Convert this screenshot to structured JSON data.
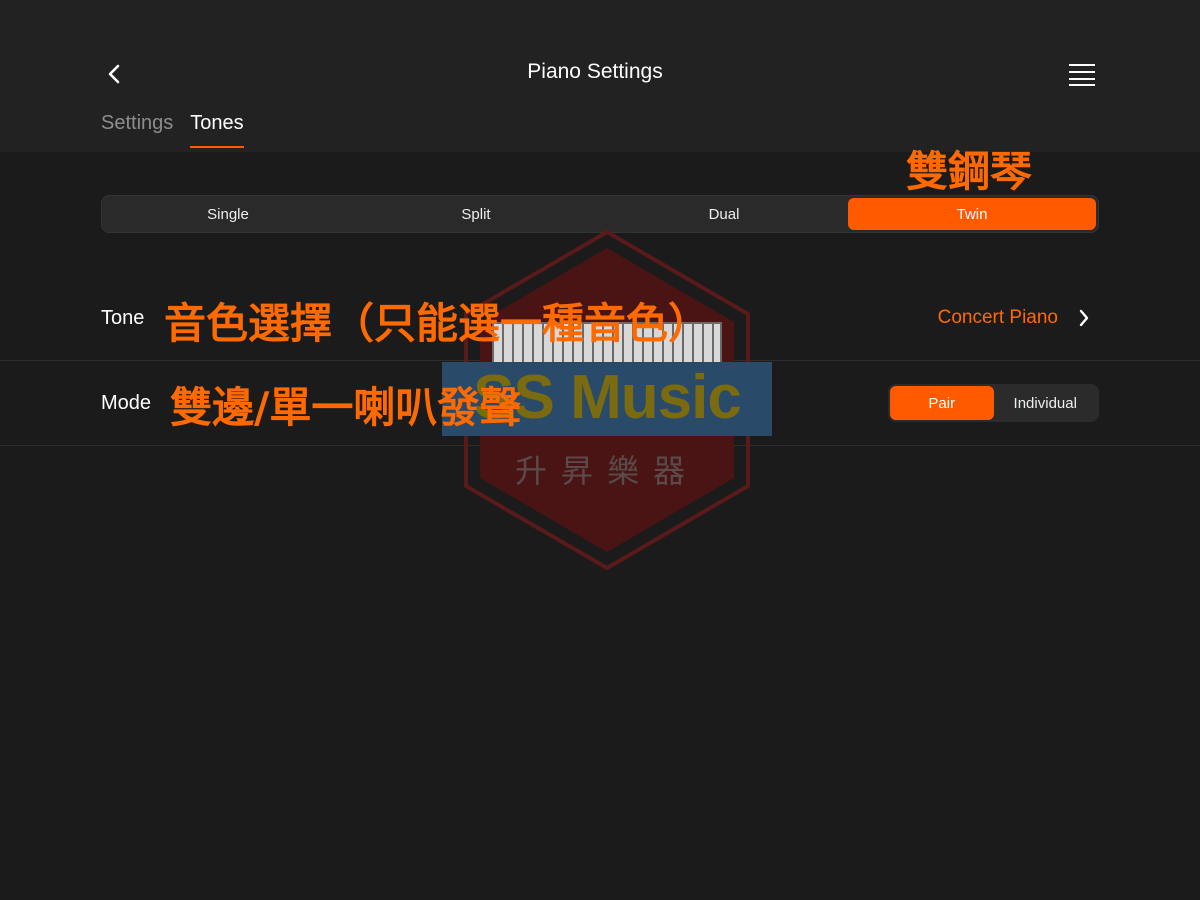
{
  "header": {
    "title": "Piano Settings",
    "back_icon": "chevron-left-icon",
    "menu_icon": "hamburger-menu-icon"
  },
  "tabs": [
    {
      "label": "Settings",
      "active": false
    },
    {
      "label": "Tones",
      "active": true
    }
  ],
  "mode_selector": {
    "options": [
      "Single",
      "Split",
      "Dual",
      "Twin"
    ],
    "selected": "Twin"
  },
  "tone_row": {
    "label": "Tone",
    "value": "Concert Piano",
    "chevron_icon": "chevron-right-icon"
  },
  "mode_row": {
    "label": "Mode",
    "options": [
      "Pair",
      "Individual"
    ],
    "selected": "Pair"
  },
  "annotations": {
    "twin": "雙鋼琴",
    "tone": "音色選擇（只能選一種音色）",
    "mode": "雙邊/單一喇叭發聲"
  },
  "watermark": {
    "logo": "SS Music",
    "subtitle": "升昇樂器"
  },
  "colors": {
    "accent": "#ff5a00",
    "background": "#1b1b1b",
    "header_background": "#222222"
  }
}
